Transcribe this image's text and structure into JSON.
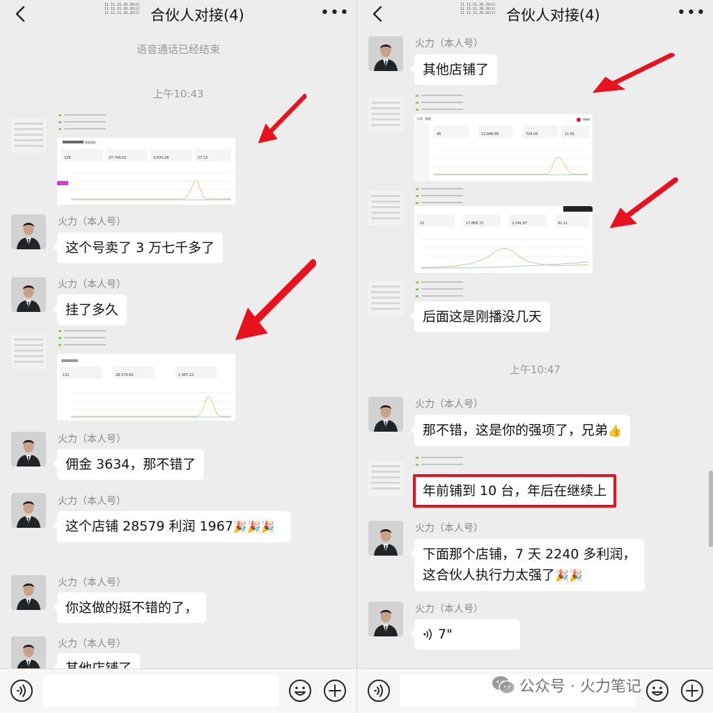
{
  "left": {
    "title": "合伙人对接(4)",
    "blur_lines": [
      "11 11.21.28.26(2)",
      "11 11.21.28.26(2)",
      "11 11.21.28.26(2)"
    ],
    "system_notice": "语音通话已经结束",
    "time_1": "上午10:43",
    "messages": [
      {
        "sender": "火力（本人号）",
        "text": "这个号卖了 3 万七千多了"
      },
      {
        "sender": "火力（本人号）",
        "text": "挂了多久"
      },
      {
        "sender": "火力（本人号）",
        "text": "佣金 3634，那不错了"
      },
      {
        "sender": "火力（本人号）",
        "text": "这个店铺 28579 利润 1967",
        "emoji": "🎉🎉🎉"
      },
      {
        "sender": "火力（本人号）",
        "text": "你这做的挺不错的了，"
      },
      {
        "sender": "火力（本人号）",
        "text": "其他店铺了"
      }
    ],
    "shot_1": {
      "title": "数据看板",
      "stats": [
        "158",
        "37,744.62",
        "3,634.28",
        "27.13"
      ]
    },
    "shot_2": {
      "stats": [
        "122",
        "28,579.60",
        "1,967.22"
      ]
    }
  },
  "right": {
    "title": "合伙人对接(4)",
    "blur_lines": [
      "11 11.21.28.26(2)",
      "11 11.21.28.26(2)",
      "11 11.21.28.26(2)"
    ],
    "messages": [
      {
        "sender": "火力（本人号）",
        "text": "其他店铺了"
      },
      {
        "text": "后面这是刚播没几天"
      },
      {
        "sender": "火力（本人号）",
        "text": "那不错，这是你的强项了，兄弟",
        "emoji": "👍"
      },
      {
        "text": "年前铺到 10 台，年后在继续上"
      },
      {
        "sender": "火力（本人号）",
        "text_line1": "下面那个店铺，7 天 2240 多利润，",
        "text_line2": "这合伙人执行力太强了",
        "emoji": "🎉🎉"
      },
      {
        "sender": "火力（本人号）",
        "voice": "7\""
      }
    ],
    "time_2": "上午10:47",
    "shot_3": {
      "title": "抖音 · 数据",
      "stats": [
        "45",
        "12,946.85",
        "704.04",
        "11.81"
      ]
    },
    "shot_4": {
      "stats": [
        "22",
        "17,868.72",
        "2,241.87",
        "42.11"
      ]
    }
  },
  "watermark": {
    "text": "公众号 · 火力笔记"
  },
  "colors": {
    "background": "#ededed",
    "bubble": "#ffffff",
    "arrow": "#e8121e",
    "highlight_border": "#e8121e"
  },
  "icons": [
    "back-icon",
    "more-icon",
    "voice-icon",
    "emoji-icon",
    "plus-icon",
    "wechat-icon"
  ]
}
